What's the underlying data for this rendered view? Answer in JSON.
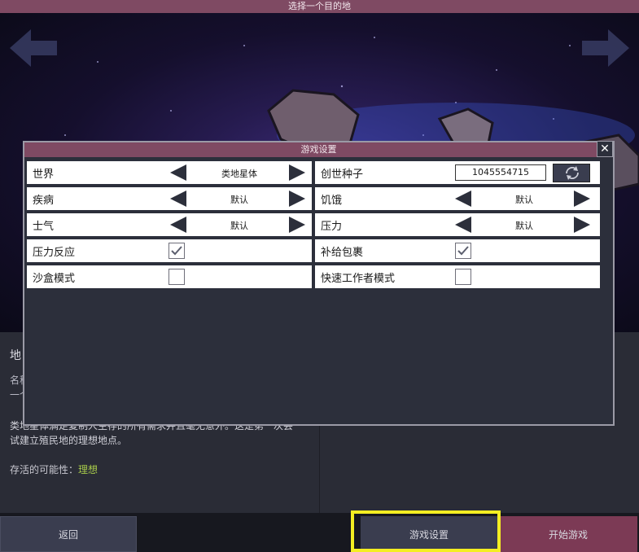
{
  "window": {
    "title": "选择一个目的地"
  },
  "planet_info": {
    "section_title": "地",
    "name_label": "名称",
    "name_value": "一个",
    "description_line1": "类地星体满足复制人生存的所有需求并且毫无意外。这是第一次尝",
    "description_line2": "试建立殖民地的理想地点。",
    "survival_label": "存活的可能性：",
    "survival_value": "理想"
  },
  "modal": {
    "title": "游戏设置",
    "close_label": "✕",
    "left_rows": [
      {
        "label": "世界",
        "value": "类地星体"
      },
      {
        "label": "疾病",
        "value": "默认"
      },
      {
        "label": "士气",
        "value": "默认"
      },
      {
        "label": "压力反应",
        "checked": true
      },
      {
        "label": "沙盒模式",
        "checked": false
      }
    ],
    "right_rows": [
      {
        "label": "创世种子",
        "value": "1045554715"
      },
      {
        "label": "饥饿",
        "value": "默认"
      },
      {
        "label": "压力",
        "value": "默认"
      },
      {
        "label": "补给包裹",
        "checked": true
      },
      {
        "label": "快速工作者模式",
        "checked": false
      }
    ]
  },
  "footer": {
    "back_label": "返回",
    "settings_label": "游戏设置",
    "start_label": "开始游戏"
  },
  "colors": {
    "accent": "#7f4a63",
    "panel": "#2c2f3b",
    "highlight": "#f4ee22",
    "survival": "#a6c94a"
  }
}
